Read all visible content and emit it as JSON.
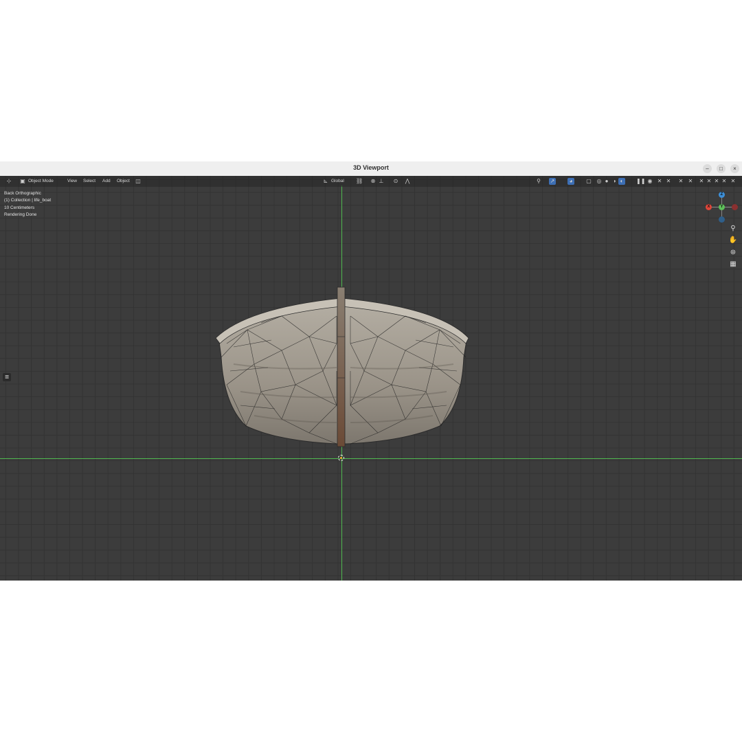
{
  "window": {
    "title": "3D Viewport",
    "buttons": [
      "–",
      "□",
      "×"
    ]
  },
  "header": {
    "mode": "Object Mode",
    "menus": [
      "View",
      "Select",
      "Add",
      "Object"
    ],
    "orientation": "Global"
  },
  "overlay": {
    "view_name": "Back Orthographic",
    "collection": "(1) Collection | life_boat",
    "scale": "10 Centimeters",
    "status": "Rendering Done"
  },
  "gizmo": {
    "x_label": "X",
    "y_label": "Y",
    "z_label": "Z"
  },
  "colors": {
    "axis_green": "#4fb84f",
    "x_red": "#e0463a",
    "y_green": "#5ec05a",
    "z_blue": "#3d8fd8",
    "viewport_bg": "#3c3c3c",
    "hull": "#a39d92"
  },
  "icons": [
    "editor-type-icon",
    "object-mode-icon",
    "transform-orientation-icon",
    "snap-icon",
    "proportional-edit-icon",
    "visibility-icon",
    "gizmo-icon",
    "overlay-icon",
    "xray-icon",
    "wireframe-shading-icon",
    "solid-shading-icon",
    "material-shading-icon",
    "rendered-shading-icon",
    "zoom-icon",
    "hand-pan-icon",
    "camera-icon",
    "grid-icon"
  ]
}
